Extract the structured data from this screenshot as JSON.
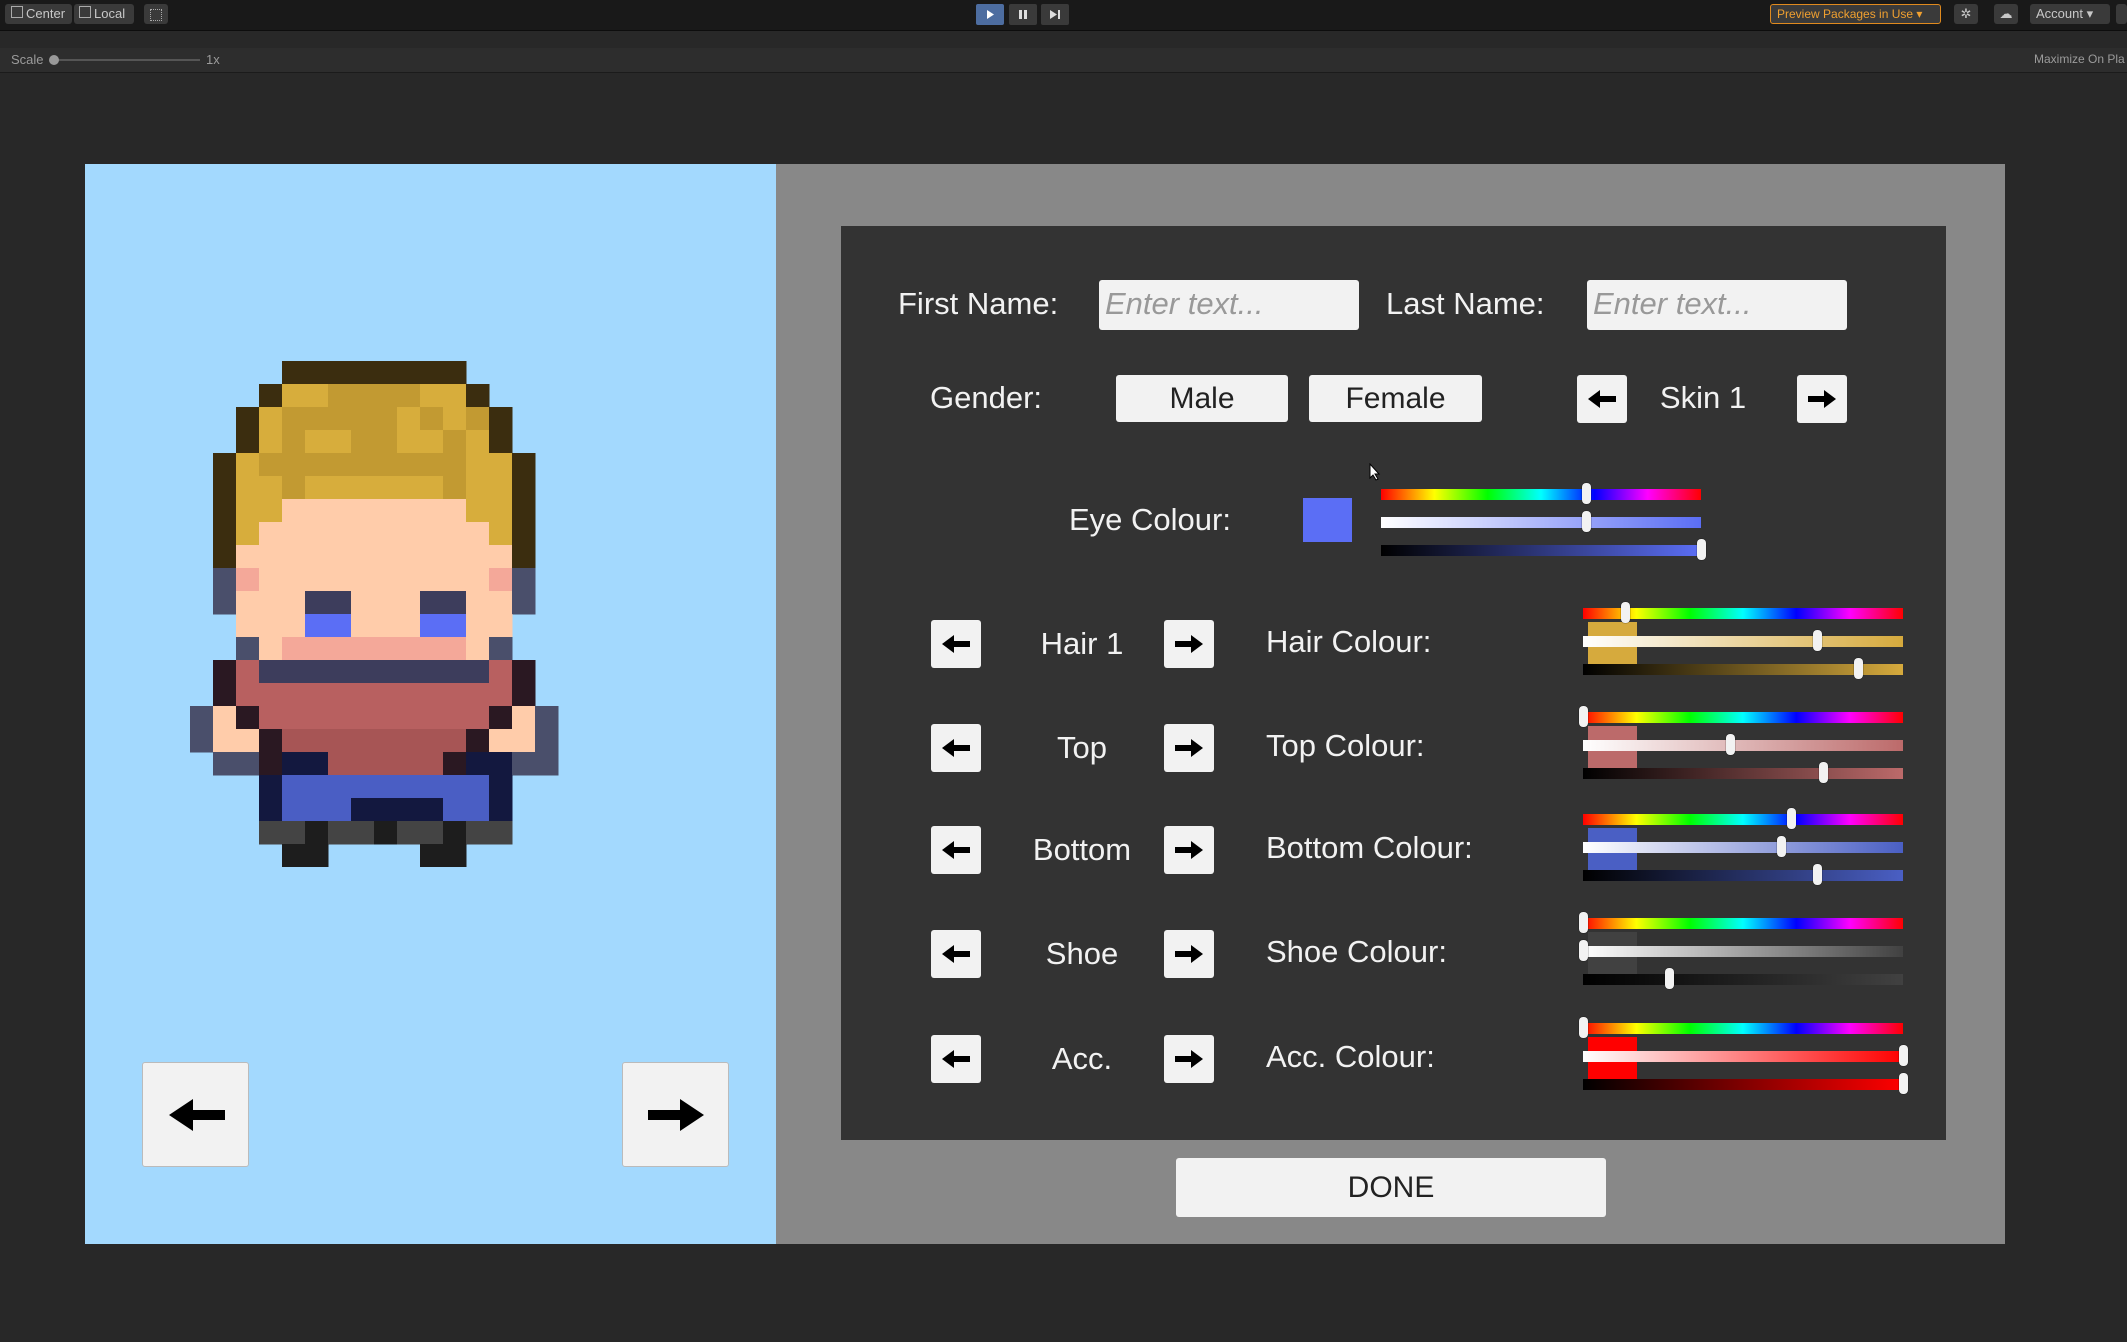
{
  "toolbar": {
    "center_label": "Center",
    "local_label": "Local",
    "preview_packages_label": "Preview Packages in Use",
    "account_label": "Account"
  },
  "scalebar": {
    "scale_label": "Scale",
    "scale_value": "1x",
    "maximize_label": "Maximize On Pla"
  },
  "form": {
    "first_name_label": "First Name:",
    "first_name_placeholder": "Enter text...",
    "last_name_label": "Last Name:",
    "last_name_placeholder": "Enter text...",
    "gender_label": "Gender:",
    "male_label": "Male",
    "female_label": "Female",
    "skin_label": "Skin 1",
    "eye_colour_label": "Eye Colour:",
    "eye_colour": "#5b6ef5",
    "eye_sliders": [
      0.64,
      0.64,
      1.0
    ],
    "parts": [
      {
        "part_label": "Hair 1",
        "colour_label": "Hair Colour:",
        "colour": "#d6aa3d",
        "sliders": [
          0.13,
          0.73,
          0.86
        ]
      },
      {
        "part_label": "Top",
        "colour_label": "Top Colour:",
        "colour": "#bc6a6a",
        "sliders": [
          0.0,
          0.46,
          0.75
        ]
      },
      {
        "part_label": "Bottom",
        "colour_label": "Bottom Colour:",
        "colour": "#4a5fc4",
        "sliders": [
          0.65,
          0.62,
          0.73
        ]
      },
      {
        "part_label": "Shoe",
        "colour_label": "Shoe Colour:",
        "colour": "#414141",
        "sliders": [
          0.0,
          0.0,
          0.27
        ]
      },
      {
        "part_label": "Acc.",
        "colour_label": "Acc. Colour:",
        "colour": "#ff0000",
        "sliders": [
          0.0,
          1.0,
          1.0
        ]
      }
    ],
    "done_label": "DONE"
  }
}
